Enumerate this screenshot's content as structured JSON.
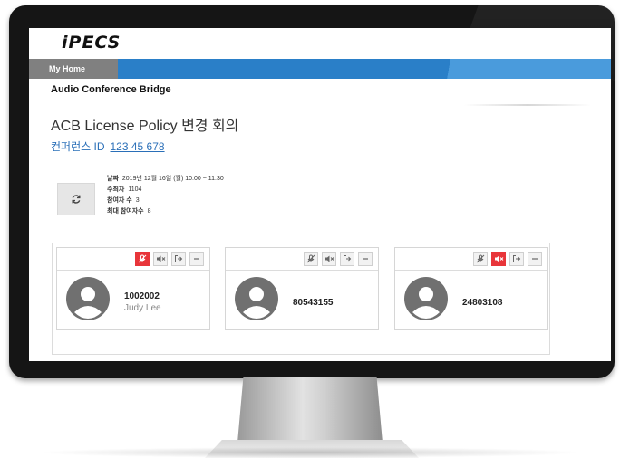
{
  "app": {
    "logo": "iPECS"
  },
  "nav": {
    "home_label": "My Home"
  },
  "page": {
    "section_title": "Audio Conference Bridge",
    "conference_title": "ACB License Policy 변경 회의",
    "conference_id_label": "컨퍼런스 ID",
    "conference_id": "123 45 678"
  },
  "info": {
    "date_label": "날짜",
    "date_value": "2019년 12월 16일 (월) 10:00 ~ 11:30",
    "host_label": "주최자",
    "host_value": "1104",
    "participants_label": "참여자 수",
    "participants_value": "3",
    "max_participants_label": "최대 참여자수",
    "max_participants_value": "8"
  },
  "icons": {
    "refresh": "refresh-icon",
    "mic_off": "mic-off-icon",
    "speaker_mute": "speaker-mute-icon",
    "exit": "exit-icon",
    "minus": "minus-icon",
    "avatar": "avatar-icon"
  },
  "colors": {
    "accent": "#2a7fc8",
    "active_red": "#e8353a",
    "link": "#2a6fb8"
  },
  "participants": [
    {
      "number": "1002002",
      "name": "Judy Lee",
      "mic_muted_active": true,
      "speaker_muted_active": false
    },
    {
      "number": "80543155",
      "name": "",
      "mic_muted_active": false,
      "speaker_muted_active": false
    },
    {
      "number": "24803108",
      "name": "",
      "mic_muted_active": false,
      "speaker_muted_active": true
    }
  ]
}
